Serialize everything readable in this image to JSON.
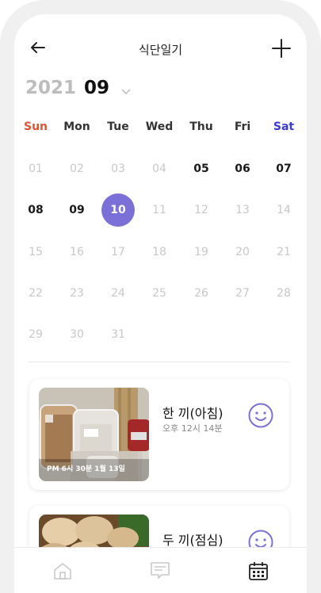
{
  "header": {
    "title": "식단일기"
  },
  "calendar": {
    "year": "2021",
    "month": "09",
    "weekdays": [
      "Sun",
      "Mon",
      "Tue",
      "Wed",
      "Thu",
      "Fri",
      "Sat"
    ],
    "days": [
      "01",
      "02",
      "03",
      "04",
      "05",
      "06",
      "07",
      "08",
      "09",
      "10",
      "11",
      "12",
      "13",
      "14",
      "15",
      "16",
      "17",
      "18",
      "19",
      "20",
      "21",
      "22",
      "23",
      "24",
      "25",
      "26",
      "27",
      "28",
      "29",
      "30",
      "31"
    ],
    "selected_day": "10",
    "colors": {
      "sunday": "#e0542e",
      "saturday": "#3a3ad8",
      "accent": "#7a70d8"
    }
  },
  "meals": [
    {
      "title": "한 끼(아침)",
      "time": "오후 12시 14분",
      "photo_caption": "PM 6시 30분 1월 13일"
    },
    {
      "title": "두 끼(점심)",
      "time": "",
      "photo_caption": ""
    }
  ],
  "bottom_nav": {
    "items": [
      "home-icon",
      "message-icon",
      "calendar-icon"
    ],
    "active": "calendar-icon"
  }
}
